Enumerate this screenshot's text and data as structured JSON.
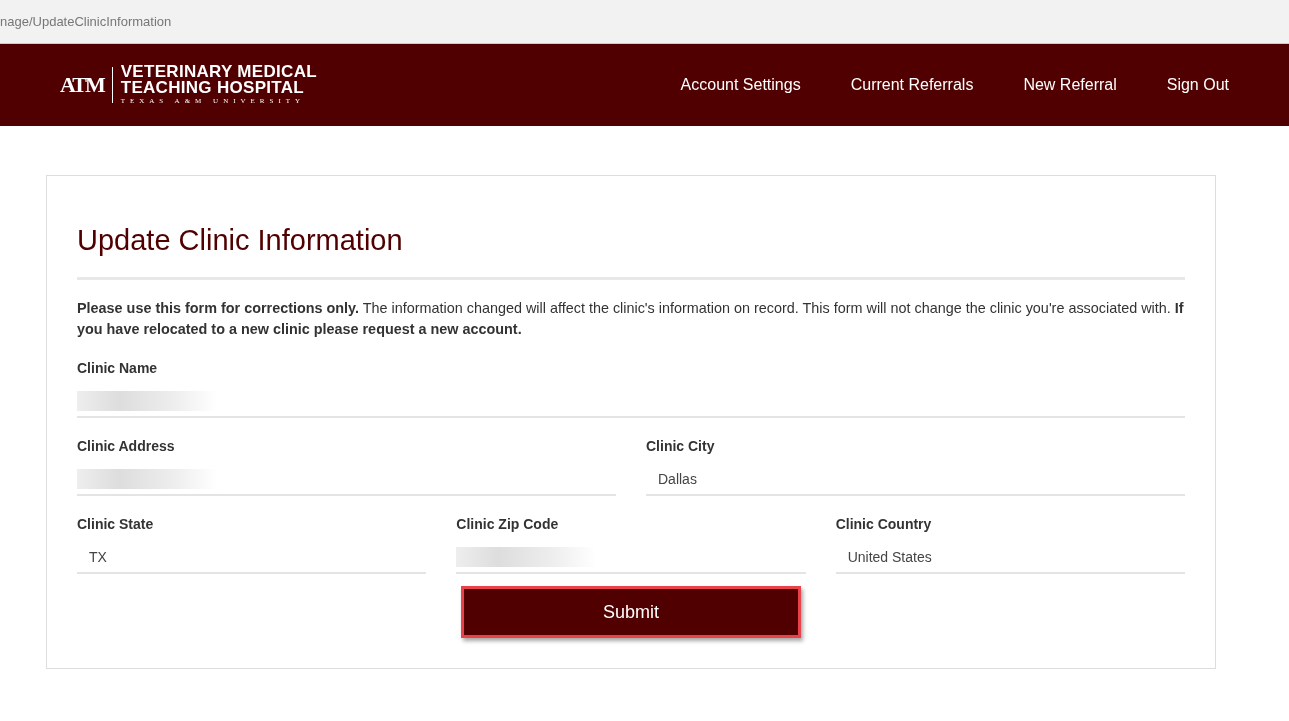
{
  "browser": {
    "url": "nage/UpdateClinicInformation"
  },
  "header": {
    "logo": {
      "monogram": "ATM",
      "line_1": "VETERINARY MEDICAL",
      "line_2": "TEACHING HOSPITAL",
      "line_3": "TEXAS A&M UNIVERSITY"
    },
    "nav": [
      "Account Settings",
      "Current Referrals",
      "New Referral",
      "Sign Out"
    ]
  },
  "form": {
    "title": "Update Clinic Information",
    "intro": "**Please use this form for corrections only.** The information changed will affect the clinic's information on record. This form will not change the clinic you're associated with. **If you have relocated to a new clinic please request a new account.**",
    "rows": [
      [
        {
          "label": "Clinic Name",
          "redacted": true
        }
      ],
      [
        {
          "label": "Clinic Address",
          "redacted": true
        },
        {
          "label": "Clinic City",
          "value": "Dallas",
          "redacted": false
        }
      ],
      [
        {
          "label": "Clinic State",
          "value": "TX",
          "redacted": false
        },
        {
          "label": "Clinic Zip Code",
          "redacted": true
        },
        {
          "label": "Clinic Country",
          "value": "United States",
          "redacted": false
        }
      ]
    ],
    "submit": "Submit"
  }
}
